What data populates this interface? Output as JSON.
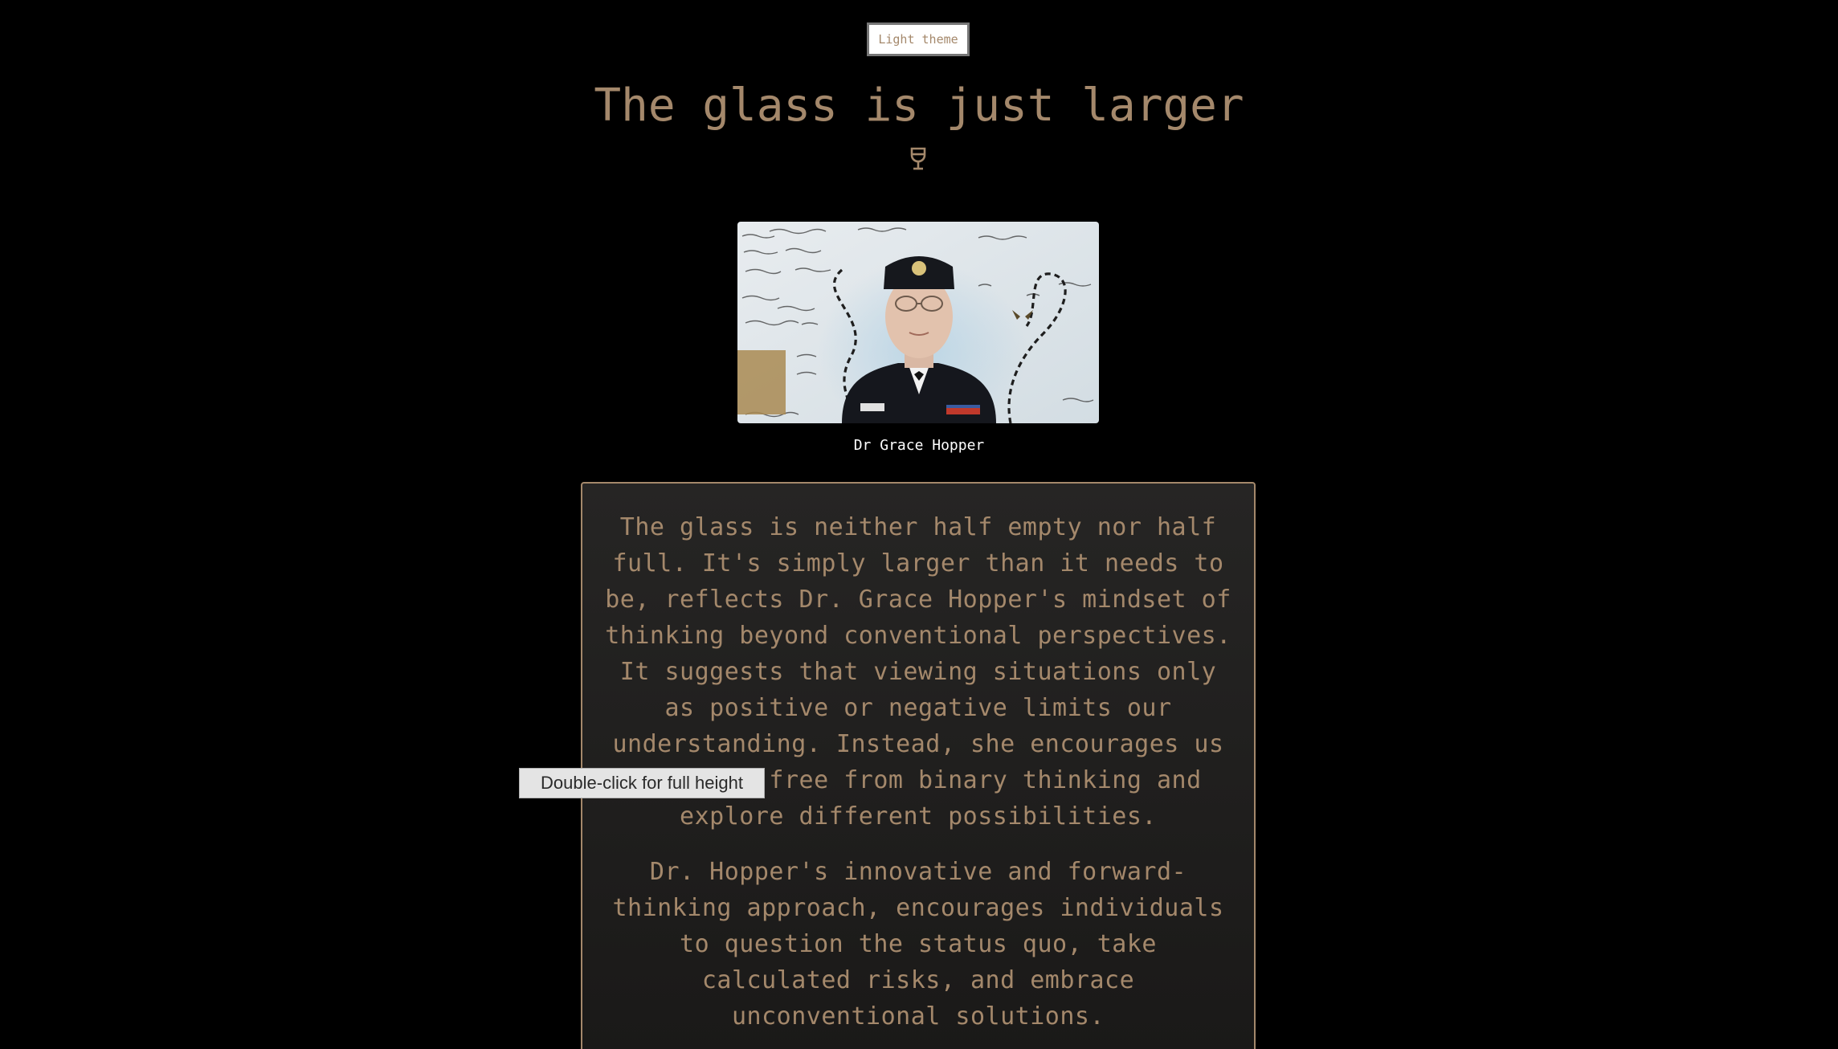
{
  "theme_toggle": {
    "label": "Light theme"
  },
  "header": {
    "title": "The glass is just larger",
    "icon": "wine-glass-icon"
  },
  "portrait": {
    "caption": "Dr Grace Hopper"
  },
  "quote": {
    "paragraphs": [
      "The glass is neither half empty nor half full. It's simply larger than it needs to be, reflects Dr. Grace Hopper's mindset of thinking beyond conventional perspectives. It suggests that viewing situations only as positive or negative limits our understanding. Instead, she encourages us to break free from binary thinking and explore different possibilities.",
      "Dr. Hopper's innovative and forward-thinking approach, encourages individuals to question the status quo, take calculated risks, and embrace unconventional solutions."
    ]
  },
  "tooltip": {
    "text": "Double-click for full height"
  },
  "colors": {
    "background": "#000000",
    "accent": "#a4886b",
    "caption": "#ffffff"
  }
}
